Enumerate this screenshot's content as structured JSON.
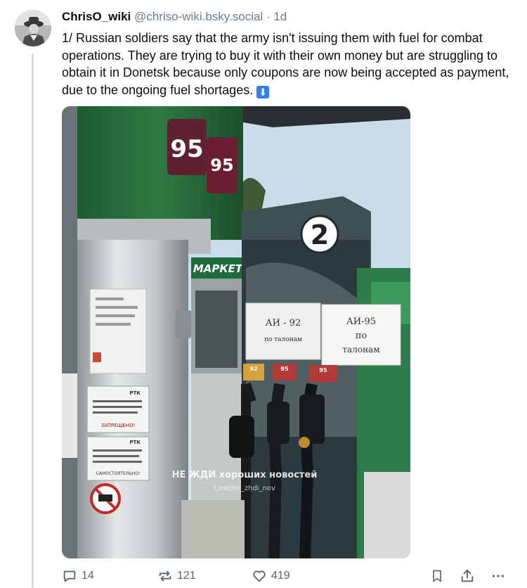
{
  "post": {
    "display_name": "ChrisO_wiki",
    "handle": "@chriso-wiki.bsky.social",
    "separator": "·",
    "timestamp": "1d",
    "text": "1/ Russian soldiers say that the army isn't issuing them with fuel for combat operations. They are trying to buy it with their own money but are struggling to obtain it in Donetsk because only coupons are now being accepted as payment, due to the ongoing fuel shortages.",
    "emoji": "⬇"
  },
  "media": {
    "price_sign_left": "95",
    "price_sign_right": "95",
    "pump_number": "2",
    "store_sign": "МАРКЕТ",
    "sign_ai92_line1": "АИ - 92",
    "sign_ai92_line2": "по талонам",
    "sign_ai95_line1": "АИ-95",
    "sign_ai95_line2": "по",
    "sign_ai95_line3": "талонам",
    "nozzle_92": "92",
    "nozzle_95a": "95",
    "nozzle_95b": "95",
    "rtk_label_1": "РТК",
    "rtk_label_2": "РТК",
    "notice_1": "ЗАПРЕЩЕНО!",
    "notice_2": "САМОСТОЯТЕЛЬНО!",
    "watermark_line1": "НЕ ЖДИ хороших новостей",
    "watermark_line2": "t.me/ne_zhdi_nov"
  },
  "actions": {
    "replies": "14",
    "reposts": "121",
    "likes": "419"
  },
  "icons": {
    "reply": "speech-bubble-icon",
    "repost": "repost-arrows-icon",
    "like": "heart-icon",
    "bookmark": "bookmark-icon",
    "share": "share-icon",
    "more": "ellipsis-icon"
  },
  "colors": {
    "text": "#0b0f14",
    "muted": "#6f7b88",
    "emoji_blue": "#2f80ed",
    "thread_line": "#d4dbe2"
  }
}
